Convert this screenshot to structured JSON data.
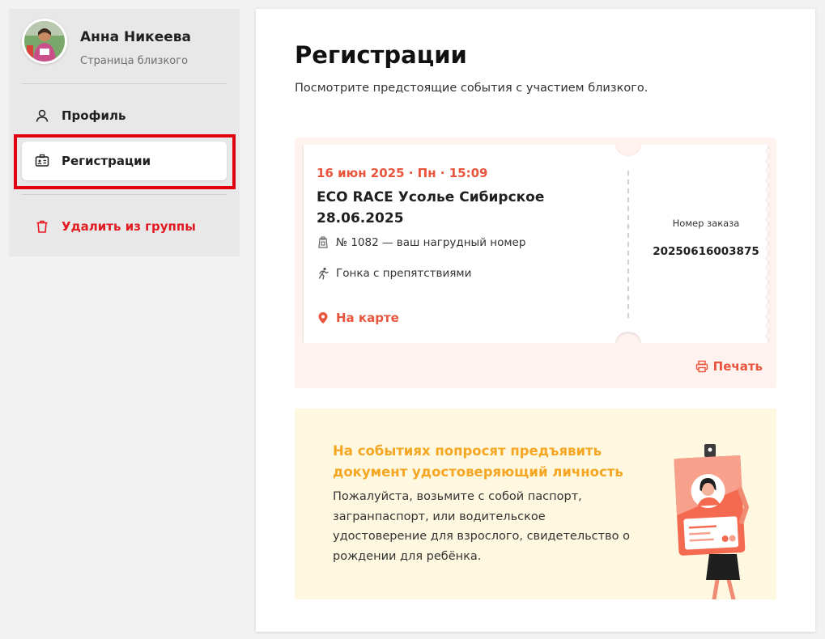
{
  "user": {
    "name": "Анна Никеева",
    "subtitle": "Страница близкого"
  },
  "nav": {
    "profile": "Профиль",
    "registrations": "Регистрации",
    "remove": "Удалить из группы"
  },
  "page": {
    "title": "Регистрации",
    "subtitle": "Посмотрите предстоящие события с участием близкого."
  },
  "ticket": {
    "date": "16 июн 2025 · Пн · 15:09",
    "event_name": "ECO RACE Усолье Сибирское 28.06.2025",
    "bib": "№ 1082 — ваш нагрудный номер",
    "race_type": "Гонка с препятствиями",
    "map_link": "На карте",
    "order_label": "Номер заказа",
    "order_number": "20250616003875",
    "print": "Печать"
  },
  "document_notice": {
    "title": "На событиях попросят предъявить документ удостоверяющий личность",
    "text": "Пожалуйста, возьмите с собой паспорт, загранпаспорт, или водительское удостоверение для взрослого, свидетельство о рождении для ребёнка."
  },
  "colors": {
    "accent": "#e8553c",
    "danger": "#e21a22",
    "notice_title": "#f5a623",
    "notice_bg": "#fff8e1",
    "ticket_bg": "#fff2ef",
    "highlight": "#e00012"
  }
}
